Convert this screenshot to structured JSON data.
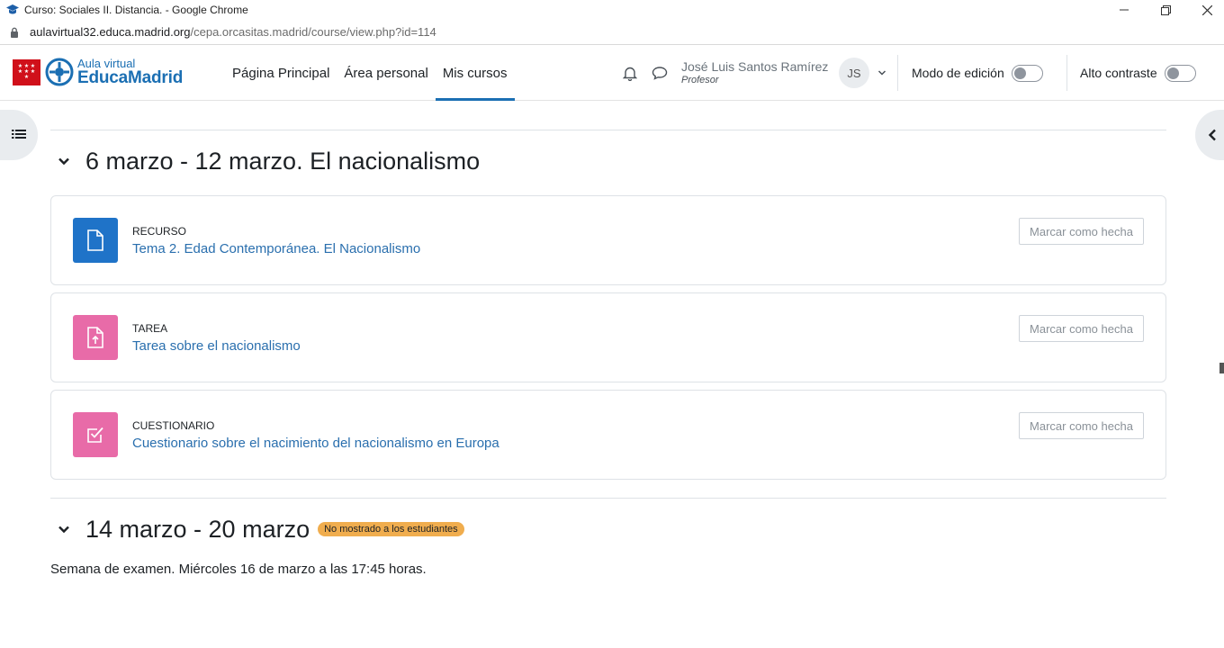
{
  "browser": {
    "window_title": "Curso: Sociales II. Distancia. - Google Chrome",
    "url_domain": "aulavirtual32.educa.madrid.org",
    "url_path": "/cepa.orcasitas.madrid/course/view.php?id=114"
  },
  "brand": {
    "line1": "Aula virtual",
    "line2": "EducaMadrid"
  },
  "nav": {
    "links": [
      "Página Principal",
      "Área personal",
      "Mis cursos"
    ],
    "active": "Mis cursos"
  },
  "user": {
    "name": "José Luis Santos Ramírez",
    "role": "Profesor",
    "initials": "JS"
  },
  "toggles": {
    "edit_mode": "Modo de edición",
    "high_contrast": "Alto contraste"
  },
  "sections": [
    {
      "title": "6 marzo - 12 marzo. El nacionalismo",
      "activities": [
        {
          "type": "RECURSO",
          "name": "Tema 2. Edad Contemporánea. El Nacionalismo",
          "icon": "file-icon",
          "color": "#1f73c8",
          "button": "Marcar como hecha"
        },
        {
          "type": "TAREA",
          "name": "Tarea sobre el nacionalismo",
          "icon": "upload-file-icon",
          "color": "#e86ba8",
          "button": "Marcar como hecha"
        },
        {
          "type": "CUESTIONARIO",
          "name": "Cuestionario sobre el nacimiento del nacionalismo en Europa",
          "icon": "checkbox-icon",
          "color": "#e86ba8",
          "button": "Marcar como hecha"
        }
      ]
    },
    {
      "title": "14 marzo - 20 marzo",
      "badge": "No mostrado a los estudiantes",
      "summary": "Semana de examen. Miércoles 16 de marzo a las 17:45 horas."
    }
  ]
}
